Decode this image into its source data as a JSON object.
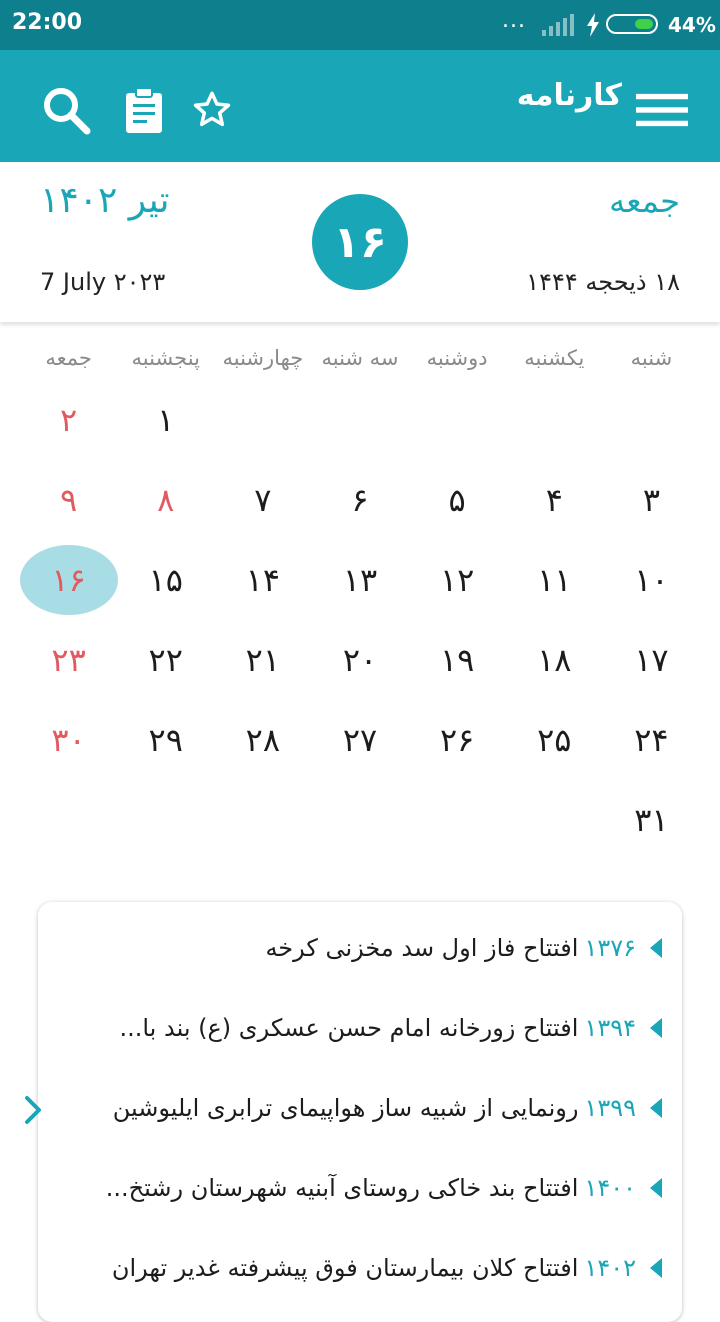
{
  "status_bar": {
    "time": "22:00",
    "dots": "...",
    "battery": "44%"
  },
  "app_bar": {
    "title": "کارنامه",
    "icons": [
      "menu-icon",
      "search-icon",
      "clipboard-icon",
      "star-icon"
    ]
  },
  "header": {
    "weekday": "جمعه",
    "month_year": "تیر ۱۴۰۲",
    "day": "۱۶",
    "hijri": "۱۸ ذیحجه ۱۴۴۴",
    "gregorian": "7 July  ۲۰۲۳"
  },
  "weekdays": [
    "شنبه",
    "یکشنبه",
    "دوشنبه",
    "سه شنبه",
    "چهارشنبه",
    "پنجشنبه",
    "جمعه"
  ],
  "calendar_rows": [
    [
      {
        "d": ""
      },
      {
        "d": ""
      },
      {
        "d": ""
      },
      {
        "d": ""
      },
      {
        "d": ""
      },
      {
        "d": "۱"
      },
      {
        "d": "۲",
        "holiday": true
      }
    ],
    [
      {
        "d": "۳"
      },
      {
        "d": "۴"
      },
      {
        "d": "۵"
      },
      {
        "d": "۶"
      },
      {
        "d": "۷"
      },
      {
        "d": "۸",
        "holiday": true
      },
      {
        "d": "۹",
        "holiday": true
      }
    ],
    [
      {
        "d": "۱۰"
      },
      {
        "d": "۱۱"
      },
      {
        "d": "۱۲"
      },
      {
        "d": "۱۳"
      },
      {
        "d": "۱۴"
      },
      {
        "d": "۱۵"
      },
      {
        "d": "۱۶",
        "holiday": true,
        "today": true
      }
    ],
    [
      {
        "d": "۱۷"
      },
      {
        "d": "۱۸"
      },
      {
        "d": "۱۹"
      },
      {
        "d": "۲۰"
      },
      {
        "d": "۲۱"
      },
      {
        "d": "۲۲"
      },
      {
        "d": "۲۳",
        "holiday": true
      }
    ],
    [
      {
        "d": "۲۴"
      },
      {
        "d": "۲۵"
      },
      {
        "d": "۲۶"
      },
      {
        "d": "۲۷"
      },
      {
        "d": "۲۸"
      },
      {
        "d": "۲۹"
      },
      {
        "d": "۳۰",
        "holiday": true
      }
    ],
    [
      {
        "d": "۳۱"
      },
      {
        "d": ""
      },
      {
        "d": ""
      },
      {
        "d": ""
      },
      {
        "d": ""
      },
      {
        "d": ""
      },
      {
        "d": ""
      }
    ]
  ],
  "events": [
    {
      "year": "۱۳۷۶",
      "text": "افتتاح فاز اول سد مخزنی کرخه"
    },
    {
      "year": "۱۳۹۴",
      "text": "افتتاح زورخانه امام حسن عسکری (ع) بند با..."
    },
    {
      "year": "۱۳۹۹",
      "text": "رونمایی از شبیه ساز هواپیمای ترابری ایلیوشین"
    },
    {
      "year": "۱۴۰۰",
      "text": "افتتاح بند خاکی روستای آبنیه شهرستان رشتخ..."
    },
    {
      "year": "۱۴۰۲",
      "text": "افتتاح کلان بیمارستان فوق پیشرفته غدیر تهران"
    }
  ],
  "colors": {
    "status_bar": "#0e7f8c",
    "primary": "#19a6b6",
    "holiday": "#e05a5f",
    "today_bg": "#a9dde5"
  }
}
